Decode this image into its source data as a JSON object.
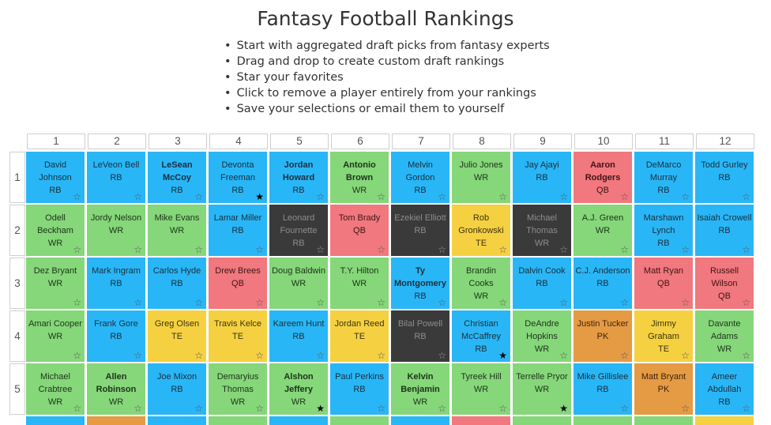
{
  "page": {
    "title": "Fantasy Football Rankings",
    "instructions": [
      "Start with aggregated draft picks from fantasy experts",
      "Drag and drop to create custom draft rankings",
      "Star your favorites",
      "Click to remove a player entirely from your rankings",
      "Save your selections or email them to yourself"
    ]
  },
  "icons": {
    "star_empty": "☆",
    "star_filled": "★"
  },
  "colors": {
    "RB": "#29b6f6",
    "WR": "#86d67a",
    "QB": "#f0787e",
    "TE": "#f5d142",
    "PK": "#e59a44",
    "removed": "#3a3a3a"
  },
  "board": {
    "round_labels": [
      "1",
      "2",
      "3",
      "4",
      "5",
      "6",
      "7",
      "8",
      "9",
      "10",
      "11",
      "12"
    ],
    "pick_labels": [
      "1",
      "2",
      "3",
      "4",
      "5"
    ],
    "rows": [
      [
        {
          "name": "David Johnson",
          "pos": "RB",
          "starred": false,
          "removed": false
        },
        {
          "name": "LeVeon Bell",
          "pos": "RB",
          "starred": false,
          "removed": false
        },
        {
          "name": "LeSean McCoy",
          "pos": "RB",
          "starred": false,
          "removed": false,
          "bold": true
        },
        {
          "name": "Devonta Freeman",
          "pos": "RB",
          "starred": true,
          "removed": false
        },
        {
          "name": "Jordan Howard",
          "pos": "RB",
          "starred": false,
          "removed": false,
          "bold": true
        },
        {
          "name": "Antonio Brown",
          "pos": "WR",
          "starred": false,
          "removed": false,
          "bold": true
        },
        {
          "name": "Melvin Gordon",
          "pos": "RB",
          "starred": false,
          "removed": false
        },
        {
          "name": "Julio Jones",
          "pos": "WR",
          "starred": false,
          "removed": false
        },
        {
          "name": "Jay Ajayi",
          "pos": "RB",
          "starred": false,
          "removed": false
        },
        {
          "name": "Aaron Rodgers",
          "pos": "QB",
          "starred": false,
          "removed": false,
          "bold": true
        },
        {
          "name": "DeMarco Murray",
          "pos": "RB",
          "starred": false,
          "removed": false
        },
        {
          "name": "Todd Gurley",
          "pos": "RB",
          "starred": false,
          "removed": false
        }
      ],
      [
        {
          "name": "Odell Beckham",
          "pos": "WR",
          "starred": false,
          "removed": false
        },
        {
          "name": "Jordy Nelson",
          "pos": "WR",
          "starred": false,
          "removed": false
        },
        {
          "name": "Mike Evans",
          "pos": "WR",
          "starred": false,
          "removed": false
        },
        {
          "name": "Lamar Miller",
          "pos": "RB",
          "starred": false,
          "removed": false
        },
        {
          "name": "Leonard Fournette",
          "pos": "RB",
          "starred": false,
          "removed": true
        },
        {
          "name": "Tom Brady",
          "pos": "QB",
          "starred": false,
          "removed": false
        },
        {
          "name": "Ezekiel Elliott",
          "pos": "RB",
          "starred": false,
          "removed": true
        },
        {
          "name": "Rob Gronkowski",
          "pos": "TE",
          "starred": false,
          "removed": false
        },
        {
          "name": "Michael Thomas",
          "pos": "WR",
          "starred": false,
          "removed": true
        },
        {
          "name": "A.J. Green",
          "pos": "WR",
          "starred": false,
          "removed": false
        },
        {
          "name": "Marshawn Lynch",
          "pos": "RB",
          "starred": false,
          "removed": false
        },
        {
          "name": "Isaiah Crowell",
          "pos": "RB",
          "starred": false,
          "removed": false
        }
      ],
      [
        {
          "name": "Dez Bryant",
          "pos": "WR",
          "starred": false,
          "removed": false
        },
        {
          "name": "Mark Ingram",
          "pos": "RB",
          "starred": false,
          "removed": false
        },
        {
          "name": "Carlos Hyde",
          "pos": "RB",
          "starred": false,
          "removed": false
        },
        {
          "name": "Drew Brees",
          "pos": "QB",
          "starred": false,
          "removed": false
        },
        {
          "name": "Doug Baldwin",
          "pos": "WR",
          "starred": false,
          "removed": false
        },
        {
          "name": "T.Y. Hilton",
          "pos": "WR",
          "starred": false,
          "removed": false
        },
        {
          "name": "Ty Montgomery",
          "pos": "RB",
          "starred": false,
          "removed": false,
          "bold": true
        },
        {
          "name": "Brandin Cooks",
          "pos": "WR",
          "starred": false,
          "removed": false
        },
        {
          "name": "Dalvin Cook",
          "pos": "RB",
          "starred": false,
          "removed": false
        },
        {
          "name": "C.J. Anderson",
          "pos": "RB",
          "starred": false,
          "removed": false
        },
        {
          "name": "Matt Ryan",
          "pos": "QB",
          "starred": false,
          "removed": false
        },
        {
          "name": "Russell Wilson",
          "pos": "QB",
          "starred": false,
          "removed": false
        }
      ],
      [
        {
          "name": "Amari Cooper",
          "pos": "WR",
          "starred": false,
          "removed": false
        },
        {
          "name": "Frank Gore",
          "pos": "RB",
          "starred": false,
          "removed": false
        },
        {
          "name": "Greg Olsen",
          "pos": "TE",
          "starred": false,
          "removed": false
        },
        {
          "name": "Travis Kelce",
          "pos": "TE",
          "starred": false,
          "removed": false
        },
        {
          "name": "Kareem Hunt",
          "pos": "RB",
          "starred": false,
          "removed": false
        },
        {
          "name": "Jordan Reed",
          "pos": "TE",
          "starred": false,
          "removed": false
        },
        {
          "name": "Bilal Powell",
          "pos": "RB",
          "starred": false,
          "removed": true
        },
        {
          "name": "Christian McCaffrey",
          "pos": "RB",
          "starred": true,
          "removed": false
        },
        {
          "name": "DeAndre Hopkins",
          "pos": "WR",
          "starred": false,
          "removed": false
        },
        {
          "name": "Justin Tucker",
          "pos": "PK",
          "starred": false,
          "removed": false
        },
        {
          "name": "Jimmy Graham",
          "pos": "TE",
          "starred": false,
          "removed": false
        },
        {
          "name": "Davante Adams",
          "pos": "WR",
          "starred": false,
          "removed": false
        }
      ],
      [
        {
          "name": "Michael Crabtree",
          "pos": "WR",
          "starred": false,
          "removed": false
        },
        {
          "name": "Allen Robinson",
          "pos": "WR",
          "starred": false,
          "removed": false,
          "bold": true
        },
        {
          "name": "Joe Mixon",
          "pos": "RB",
          "starred": false,
          "removed": false
        },
        {
          "name": "Demaryius Thomas",
          "pos": "WR",
          "starred": false,
          "removed": false
        },
        {
          "name": "Alshon Jeffery",
          "pos": "WR",
          "starred": true,
          "removed": false,
          "bold": true
        },
        {
          "name": "Paul Perkins",
          "pos": "RB",
          "starred": false,
          "removed": false
        },
        {
          "name": "Kelvin Benjamin",
          "pos": "WR",
          "starred": false,
          "removed": false,
          "bold": true
        },
        {
          "name": "Tyreek Hill",
          "pos": "WR",
          "starred": false,
          "removed": false
        },
        {
          "name": "Terrelle Pryor",
          "pos": "WR",
          "starred": true,
          "removed": false
        },
        {
          "name": "Mike Gillislee",
          "pos": "RB",
          "starred": false,
          "removed": false
        },
        {
          "name": "Matt Bryant",
          "pos": "PK",
          "starred": false,
          "removed": false
        },
        {
          "name": "Ameer Abdullah",
          "pos": "RB",
          "starred": false,
          "removed": false
        }
      ]
    ],
    "next_row_positions": [
      "RB",
      "PK",
      "RB",
      "WR",
      "RB",
      "WR",
      "RB",
      "QB",
      "WR",
      "WR",
      "WR",
      "TE"
    ]
  }
}
